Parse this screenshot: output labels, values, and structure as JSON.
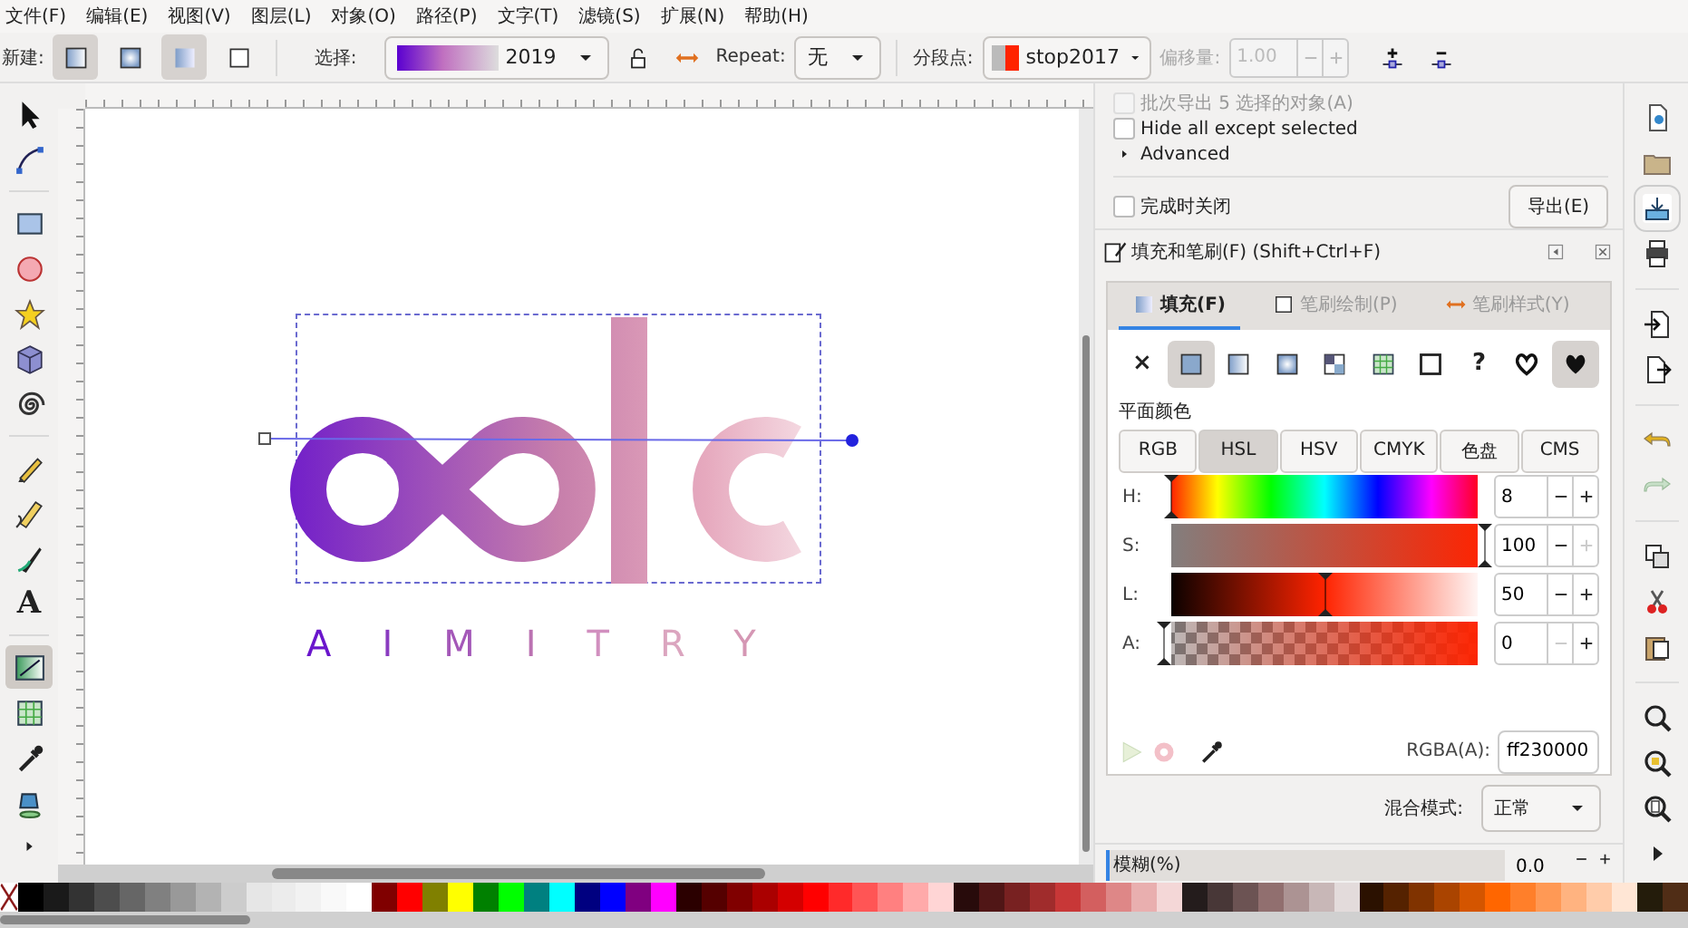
{
  "menu": [
    "文件(F)",
    "编辑(E)",
    "视图(V)",
    "图层(L)",
    "对象(O)",
    "路径(P)",
    "文字(T)",
    "滤镜(S)",
    "扩展(N)",
    "帮助(H)"
  ],
  "toolbar": {
    "new_label": "新建:",
    "new_buttons": [
      {
        "kind": "linear",
        "selected": true
      },
      {
        "kind": "radial",
        "selected": false
      }
    ],
    "target_buttons": [
      {
        "kind": "fill",
        "selected": true
      },
      {
        "kind": "stroke",
        "selected": false
      }
    ],
    "select_label": "选择:",
    "gradient_value": "2019",
    "repeat_label": "Repeat:",
    "repeat_value": "无",
    "stops_label": "分段点:",
    "stop_value": "stop2017",
    "offset_label": "偏移量:",
    "offset_value": "1.00",
    "offset_disabled": true
  },
  "tools": [
    {
      "kind": "selector",
      "selected": false
    },
    {
      "kind": "node",
      "selected": false
    },
    {
      "kind": "rect",
      "selected": false
    },
    {
      "kind": "ellipse",
      "selected": false
    },
    {
      "kind": "star",
      "selected": false
    },
    {
      "kind": "box3d",
      "selected": false
    },
    {
      "kind": "spiral",
      "selected": false
    },
    {
      "kind": "pencil",
      "selected": false
    },
    {
      "kind": "pen",
      "selected": false
    },
    {
      "kind": "calligraphy",
      "selected": false
    },
    {
      "kind": "text",
      "glyph": "A",
      "selected": false
    },
    {
      "kind": "gradient",
      "selected": true
    },
    {
      "kind": "mesh",
      "selected": false
    },
    {
      "kind": "dropper",
      "selected": false
    },
    {
      "kind": "bucket",
      "selected": false
    }
  ],
  "canvas": {
    "caption": "AIMITRY"
  },
  "export_panel": {
    "options": [
      {
        "label": "批次导出 5 选择的对象(A)",
        "checked": false,
        "disabled": true
      },
      {
        "label": "Hide all except selected",
        "checked": false,
        "disabled": false
      }
    ],
    "advanced": {
      "label": "Advanced",
      "expanded": false
    },
    "close_when_done": {
      "label": "完成时关闭",
      "checked": false
    },
    "export_button": "导出(E)"
  },
  "fill_stroke": {
    "title": "填充和笔刷(F) (Shift+Ctrl+F)",
    "tabs": [
      {
        "label": "填充(F)",
        "kind": "fill",
        "selected": true
      },
      {
        "label": "笔刷绘制(P)",
        "kind": "stroke",
        "selected": false
      },
      {
        "label": "笔刷样式(Y)",
        "kind": "style",
        "selected": false
      }
    ],
    "paint_types": [
      {
        "kind": "none",
        "glyph": "×",
        "selected": false
      },
      {
        "kind": "flat",
        "selected": true
      },
      {
        "kind": "linear",
        "selected": false
      },
      {
        "kind": "radial",
        "selected": false
      },
      {
        "kind": "pattern",
        "selected": false
      },
      {
        "kind": "mesh",
        "selected": false
      },
      {
        "kind": "swatch",
        "selected": false
      },
      {
        "kind": "unset",
        "glyph": "?",
        "selected": false
      },
      {
        "kind": "evenodd",
        "selected": false
      },
      {
        "kind": "nonzero",
        "selected": true
      }
    ],
    "section_label": "平面颜色",
    "modes": [
      {
        "label": "RGB",
        "selected": false
      },
      {
        "label": "HSL",
        "selected": true
      },
      {
        "label": "HSV",
        "selected": false
      },
      {
        "label": "CMYK",
        "selected": false
      },
      {
        "label": "色盘",
        "selected": false
      },
      {
        "label": "CMS",
        "selected": false
      }
    ],
    "sliders": [
      {
        "label": "H:",
        "kind": "hue",
        "level": 0.02,
        "value": "8",
        "minus_disabled": false,
        "plus_disabled": false
      },
      {
        "label": "S:",
        "kind": "saturation",
        "level": 1,
        "value": "100",
        "minus_disabled": false,
        "plus_disabled": true
      },
      {
        "label": "L:",
        "kind": "lightness",
        "level": 0.5,
        "value": "50",
        "minus_disabled": false,
        "plus_disabled": false
      },
      {
        "label": "A:",
        "kind": "alpha",
        "level": 0,
        "value": "0",
        "minus_disabled": true,
        "plus_disabled": false
      }
    ],
    "rgba_label": "RGBA(A):",
    "rgba_value": "ff230000",
    "blend_label": "混合模式:",
    "blend_value": "正常",
    "blur": {
      "label": "模糊(%)",
      "value": "0.0",
      "level": 0
    }
  },
  "palette": [
    {
      "color": "#000000"
    },
    {
      "color": "#1a1a1a"
    },
    {
      "color": "#333333"
    },
    {
      "color": "#4d4d4d"
    },
    {
      "color": "#666666"
    },
    {
      "color": "#808080"
    },
    {
      "color": "#999999"
    },
    {
      "color": "#b3b3b3"
    },
    {
      "color": "#cccccc"
    },
    {
      "color": "#e6e6e6"
    },
    {
      "color": "#ececec"
    },
    {
      "color": "#f2f2f2"
    },
    {
      "color": "#f9f9f9"
    },
    {
      "color": "#ffffff"
    },
    {
      "color": "#800000"
    },
    {
      "color": "#ff0000"
    },
    {
      "color": "#808000"
    },
    {
      "color": "#ffff00"
    },
    {
      "color": "#008000"
    },
    {
      "color": "#00ff00"
    },
    {
      "color": "#008080"
    },
    {
      "color": "#00ffff"
    },
    {
      "color": "#000080"
    },
    {
      "color": "#0000ff"
    },
    {
      "color": "#800080"
    },
    {
      "color": "#ff00ff"
    },
    {
      "color": "#2b0000"
    },
    {
      "color": "#550000"
    },
    {
      "color": "#800000"
    },
    {
      "color": "#aa0000"
    },
    {
      "color": "#d40000"
    },
    {
      "color": "#ff0000"
    },
    {
      "color": "#ff2a2a"
    },
    {
      "color": "#ff5555"
    },
    {
      "color": "#ff8080"
    },
    {
      "color": "#ffaaaa"
    },
    {
      "color": "#ffd5d5"
    },
    {
      "color": "#280b0b"
    },
    {
      "color": "#501616"
    },
    {
      "color": "#782121"
    },
    {
      "color": "#a02c2c"
    },
    {
      "color": "#c83737"
    },
    {
      "color": "#d35f5f"
    },
    {
      "color": "#de8787"
    },
    {
      "color": "#e9afaf"
    },
    {
      "color": "#f4d7d7"
    },
    {
      "color": "#241c1c"
    },
    {
      "color": "#483737"
    },
    {
      "color": "#6c5353"
    },
    {
      "color": "#916f6f"
    },
    {
      "color": "#ac9393"
    },
    {
      "color": "#c8b7b7"
    },
    {
      "color": "#e3dbdb"
    },
    {
      "color": "#2b1100"
    },
    {
      "color": "#552200"
    },
    {
      "color": "#803300"
    },
    {
      "color": "#aa4400"
    },
    {
      "color": "#d45500"
    },
    {
      "color": "#ff6600"
    },
    {
      "color": "#ff7f2a"
    },
    {
      "color": "#ff9955"
    },
    {
      "color": "#ffb380"
    },
    {
      "color": "#ffccaa"
    },
    {
      "color": "#ffe6d5"
    },
    {
      "color": "#241c0b"
    },
    {
      "color": "#502d16"
    }
  ]
}
